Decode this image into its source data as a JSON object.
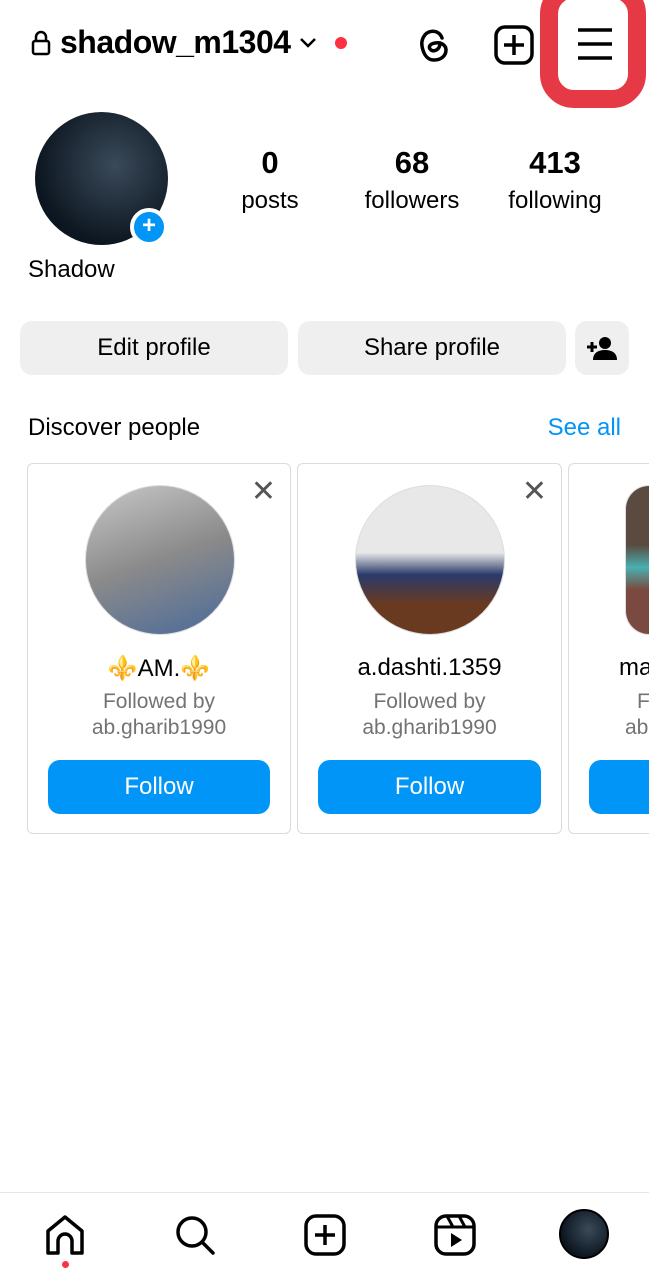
{
  "header": {
    "username": "shadow_m1304",
    "icons": [
      "lock-icon",
      "chevron-down-icon",
      "threads-icon",
      "new-post-icon",
      "menu-icon"
    ]
  },
  "profile": {
    "display_name": "Shadow",
    "stats": [
      {
        "value": "0",
        "label": "posts"
      },
      {
        "value": "68",
        "label": "followers"
      },
      {
        "value": "413",
        "label": "following"
      }
    ]
  },
  "actions": {
    "edit": "Edit profile",
    "share": "Share profile"
  },
  "discover": {
    "title": "Discover people",
    "see_all": "See all",
    "cards": [
      {
        "name": "⚜️AM.⚜️",
        "line1": "Followed by",
        "line2": "ab.gharib1990",
        "follow": "Follow"
      },
      {
        "name": "a.dashti.1359",
        "line1": "Followed by",
        "line2": "ab.gharib1990",
        "follow": "Follow"
      },
      {
        "name": "ma",
        "line1": "F",
        "line2": "ab",
        "follow": ""
      }
    ]
  },
  "colors": {
    "accent": "#0095f6",
    "highlight": "#e63946",
    "notification": "#ff3040"
  }
}
